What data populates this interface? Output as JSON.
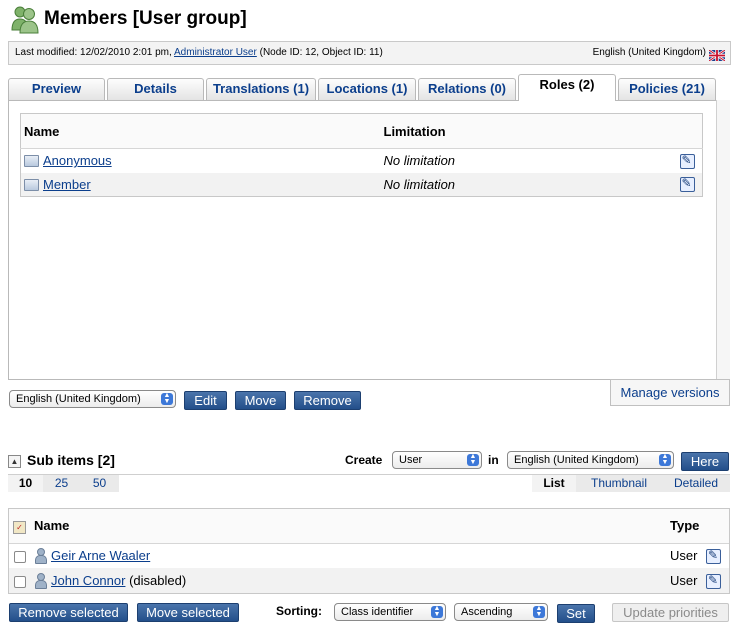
{
  "header": {
    "title": "Members [User group]"
  },
  "meta": {
    "prefix": "Last modified: 12/02/2010 2:01 pm,",
    "author": "Administrator User",
    "suffix": "(Node ID: 12, Object ID: 11)",
    "language": "English (United Kingdom)"
  },
  "tabs": [
    {
      "label": "Preview"
    },
    {
      "label": "Details"
    },
    {
      "label": "Translations (1)"
    },
    {
      "label": "Locations (1)"
    },
    {
      "label": "Relations (0)"
    },
    {
      "label": "Roles (2)"
    },
    {
      "label": "Policies (21)"
    }
  ],
  "roles": {
    "col_name": "Name",
    "col_limitation": "Limitation",
    "rows": [
      {
        "name": "Anonymous",
        "limitation": "No limitation"
      },
      {
        "name": "Member",
        "limitation": "No limitation"
      }
    ]
  },
  "actions": {
    "language_select": "English (United Kingdom)",
    "edit": "Edit",
    "move": "Move",
    "remove": "Remove",
    "manage_versions": "Manage versions"
  },
  "subitems": {
    "title": "Sub items [2]",
    "create_label": "Create",
    "class_select": "User",
    "in_label": "in",
    "language_select": "English (United Kingdom)",
    "here_button": "Here",
    "page_sizes": [
      "10",
      "25",
      "50"
    ],
    "views": [
      "List",
      "Thumbnail",
      "Detailed"
    ],
    "col_name": "Name",
    "col_type": "Type",
    "rows": [
      {
        "name": "Geir Arne Waaler",
        "extra": "",
        "type": "User"
      },
      {
        "name": "John Connor",
        "extra": "(disabled)",
        "type": "User"
      }
    ],
    "remove_selected": "Remove selected",
    "move_selected": "Move selected",
    "sorting_label": "Sorting:",
    "sort_field": "Class identifier",
    "sort_order": "Ascending",
    "set_button": "Set",
    "update_priorities": "Update priorities"
  }
}
